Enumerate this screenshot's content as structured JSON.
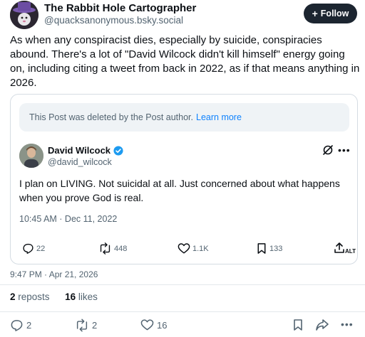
{
  "author": {
    "display_name": "The Rabbit Hole Cartographer",
    "handle": "@quacksanonymous.bsky.social",
    "follow_label": "Follow"
  },
  "post": {
    "text": "As when any conspiracist dies, especially by suicide, conspiracies abound. There's a lot of \"David Wilcock didn't kill himself\" energy going on, including citing a tweet from back in 2022, as if that means anything in 2026.",
    "timestamp": "9:47 PM · Apr 21, 2026"
  },
  "quote": {
    "deleted_text": "This Post was deleted by the Post author.",
    "learn_more": "Learn more",
    "name": "David Wilcock",
    "handle": "@david_wilcock",
    "text": "I plan on LIVING. Not suicidal at all. Just concerned about what happens when you prove God is real.",
    "time": "10:45 AM · Dec 11, 2022",
    "replies": "22",
    "reposts": "448",
    "likes": "1.1K",
    "bookmarks": "133",
    "alt_label": "ALT"
  },
  "stats": {
    "reposts_count": "2",
    "reposts_label": "reposts",
    "likes_count": "16",
    "likes_label": "likes"
  },
  "actions": {
    "replies": "2",
    "reposts": "2",
    "likes": "16"
  },
  "colors": {
    "accent": "#1083fe",
    "follow_bg": "#1c2530",
    "muted": "#536471",
    "verified": "#1d9bf0"
  }
}
